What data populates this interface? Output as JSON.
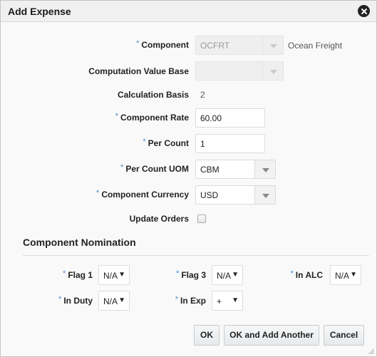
{
  "dialog": {
    "title": "Add Expense",
    "close_icon": "close-circle-icon"
  },
  "form": {
    "required_marker": "*",
    "component": {
      "label": "Component",
      "value": "OCFRT",
      "description": "Ocean Freight",
      "required": true,
      "disabled": true
    },
    "computation_value_base": {
      "label": "Computation Value Base",
      "value": "",
      "required": false,
      "disabled": true
    },
    "calculation_basis": {
      "label": "Calculation Basis",
      "value": "2"
    },
    "component_rate": {
      "label": "Component Rate",
      "value": "60.00",
      "required": true
    },
    "per_count": {
      "label": "Per Count",
      "value": "1",
      "required": true
    },
    "per_count_uom": {
      "label": "Per Count UOM",
      "value": "CBM",
      "required": true
    },
    "component_currency": {
      "label": "Component Currency",
      "value": "USD",
      "required": true
    },
    "update_orders": {
      "label": "Update Orders",
      "checked": false
    }
  },
  "nomination": {
    "title": "Component Nomination",
    "dropdown_arrow": "▼",
    "flag1": {
      "label": "Flag 1",
      "value": "N/A"
    },
    "flag3": {
      "label": "Flag 3",
      "value": "N/A"
    },
    "in_alc": {
      "label": "In ALC",
      "value": "N/A"
    },
    "in_duty": {
      "label": "In Duty",
      "value": "N/A"
    },
    "in_exp": {
      "label": "In Exp",
      "value": "+"
    }
  },
  "buttons": {
    "ok": "OK",
    "ok_and_add_another": "OK and Add Another",
    "cancel": "Cancel"
  }
}
